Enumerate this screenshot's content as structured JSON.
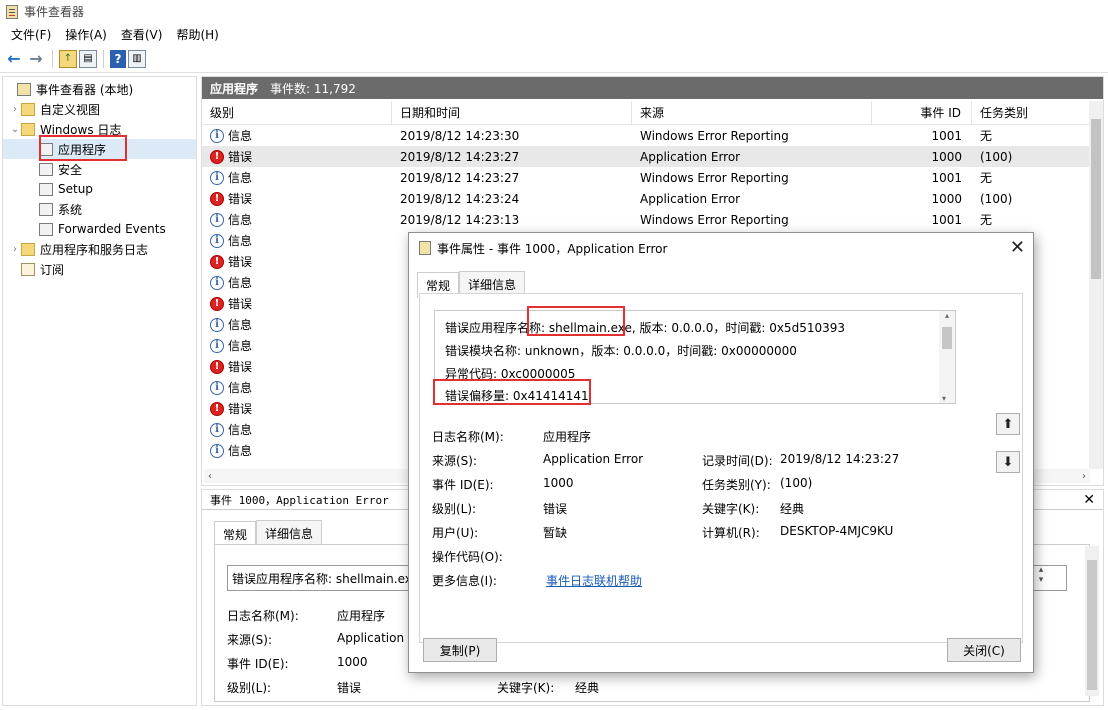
{
  "window": {
    "title": "事件查看器"
  },
  "menu": [
    "文件(F)",
    "操作(A)",
    "查看(V)",
    "帮助(H)"
  ],
  "tree": {
    "root": "事件查看器 (本地)",
    "custom_views": "自定义视图",
    "windows_logs": "Windows 日志",
    "logs": [
      "应用程序",
      "安全",
      "Setup",
      "系统",
      "Forwarded Events"
    ],
    "app_service_logs": "应用程序和服务日志",
    "subscriptions": "订阅"
  },
  "list": {
    "name": "应用程序",
    "count": "事件数: 11,792",
    "columns": [
      "级别",
      "日期和时间",
      "来源",
      "事件 ID",
      "任务类别"
    ],
    "rows": [
      {
        "level": "信息",
        "type": "info",
        "date": "2019/8/12 14:23:30",
        "source": "Windows Error Reporting",
        "id": "1001",
        "task": "无"
      },
      {
        "level": "错误",
        "type": "err",
        "date": "2019/8/12 14:23:27",
        "source": "Application Error",
        "id": "1000",
        "task": "(100)"
      },
      {
        "level": "信息",
        "type": "info",
        "date": "2019/8/12 14:23:27",
        "source": "Windows Error Reporting",
        "id": "1001",
        "task": "无"
      },
      {
        "level": "错误",
        "type": "err",
        "date": "2019/8/12 14:23:24",
        "source": "Application Error",
        "id": "1000",
        "task": "(100)"
      },
      {
        "level": "信息",
        "type": "info",
        "date": "2019/8/12 14:23:13",
        "source": "Windows Error Reporting",
        "id": "1001",
        "task": "无"
      },
      {
        "level": "信息",
        "type": "info",
        "date": "",
        "source": "",
        "id": "",
        "task": ""
      },
      {
        "level": "错误",
        "type": "err",
        "date": "",
        "source": "",
        "id": "",
        "task": ""
      },
      {
        "level": "信息",
        "type": "info",
        "date": "",
        "source": "",
        "id": "",
        "task": ""
      },
      {
        "level": "错误",
        "type": "err",
        "date": "",
        "source": "",
        "id": "",
        "task": ""
      },
      {
        "level": "信息",
        "type": "info",
        "date": "",
        "source": "",
        "id": "",
        "task": ""
      },
      {
        "level": "信息",
        "type": "info",
        "date": "",
        "source": "",
        "id": "",
        "task": ""
      },
      {
        "level": "错误",
        "type": "err",
        "date": "",
        "source": "",
        "id": "",
        "task": ""
      },
      {
        "level": "信息",
        "type": "info",
        "date": "",
        "source": "",
        "id": "",
        "task": ""
      },
      {
        "level": "错误",
        "type": "err",
        "date": "",
        "source": "",
        "id": "",
        "task": ""
      },
      {
        "level": "信息",
        "type": "info",
        "date": "",
        "source": "",
        "id": "",
        "task": ""
      },
      {
        "level": "信息",
        "type": "info",
        "date": "",
        "source": "",
        "id": "",
        "task": ""
      }
    ]
  },
  "detail": {
    "header": "事件 1000，Application Error",
    "tab_general": "常规",
    "tab_details": "详细信息",
    "msg_fragment": "错误应用程序名称: shellmain.exe",
    "log_name_label": "日志名称(M):",
    "log_name": "应用程序",
    "source_label": "来源(S):",
    "source": "Application I",
    "event_id_label": "事件 ID(E):",
    "event_id": "1000",
    "level_label": "级别(L):",
    "level": "错误",
    "keywords_label": "关键字(K):",
    "keywords": "经典"
  },
  "dialog": {
    "title": "事件属性 - 事件 1000，Application Error",
    "tab_general": "常规",
    "tab_details": "详细信息",
    "msg": {
      "line1_a": "错误应用程序名称",
      "line1_b": ": shellmain.exe,",
      "line1_c": " 版本: 0.0.0.0，时间戳: 0x5d510393",
      "line2": "错误模块名称: unknown，版本: 0.0.0.0，时间戳: 0x00000000",
      "line3": "异常代码: 0xc0000005",
      "line4": "错误偏移量: 0x41414141"
    },
    "fields": {
      "log_name_label": "日志名称(M):",
      "log_name": "应用程序",
      "source_label": "来源(S):",
      "source": "Application Error",
      "logged_label": "记录时间(D):",
      "logged": "2019/8/12 14:23:27",
      "event_id_label": "事件 ID(E):",
      "event_id": "1000",
      "task_label": "任务类别(Y):",
      "task": "(100)",
      "level_label": "级别(L):",
      "level": "错误",
      "keywords_label": "关键字(K):",
      "keywords": "经典",
      "user_label": "用户(U):",
      "user": "暂缺",
      "computer_label": "计算机(R):",
      "computer": "DESKTOP-4MJC9KU",
      "opcode_label": "操作代码(O):",
      "more_label": "更多信息(I):",
      "more_link": "事件日志联机帮助"
    },
    "copy": "复制(P)",
    "close": "关闭(C)"
  },
  "colors": {
    "highlight": "#e03030",
    "header_bg": "#6b6b6b",
    "error": "#dd2222",
    "info": "#3a65a8"
  }
}
